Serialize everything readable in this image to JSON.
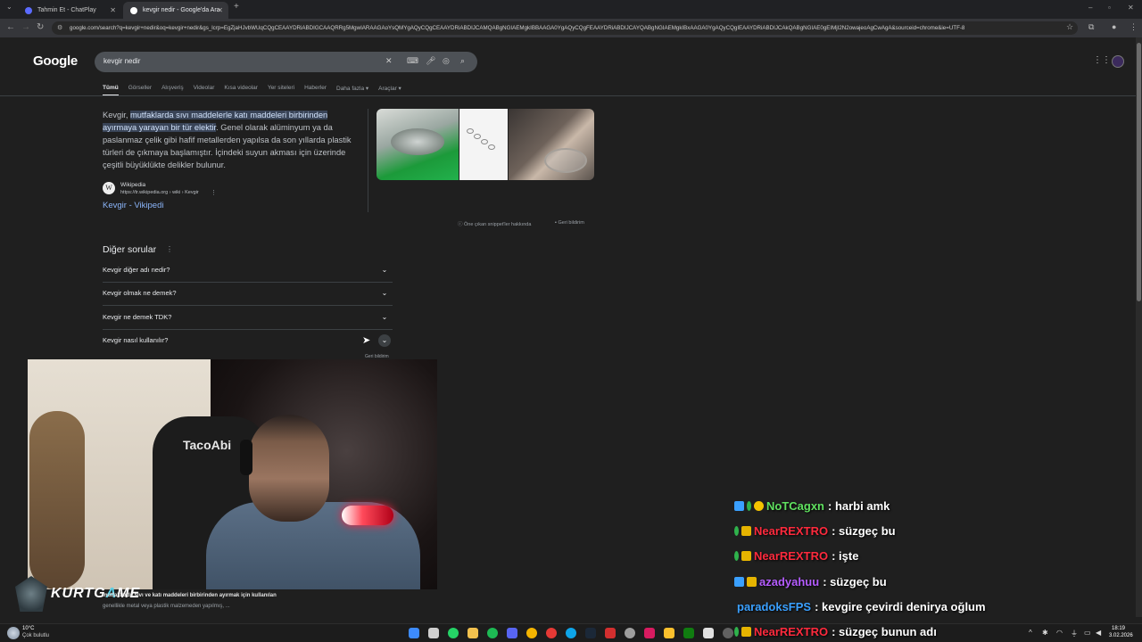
{
  "browser": {
    "tabs": [
      {
        "label": "Tahmin Et - ChatPlay",
        "active": false
      },
      {
        "label": "kevgir nedir - Google'da Ara",
        "active": true
      }
    ],
    "url": "google.com/search?q=kevgir+nedir&oq=kevgir+nedir&gs_lcrp=EgZjaHJvbWUqCQgCEAAYDRiABDIGCAAQRRg5MgwIARAAGAoYsQMYgAQyCQgCEAAYDRiABDIJCAMQABgNGIAEMgkIBBAAGA0YgAQyCQgFEAAYDRiABDIJCAYQABgNGIAEMgkIBxAAGA0YgAQyCQgIEAAYDRiABDIJCAkQABgNGIAE0gEIMjI2N2owajeoAgCwAgA&sourceid=chrome&ie=UTF-8"
  },
  "google": {
    "logo": "Google",
    "query": "kevgir nedir",
    "tabs": [
      "Tümü",
      "Görseller",
      "Alışveriş",
      "Videolar",
      "Kısa videolar",
      "Yer siteleri",
      "Haberler",
      "Daha fazla ▾",
      "Araçlar ▾"
    ],
    "snippet": {
      "prefix": "Kevgir, ",
      "highlight1": "mutfaklarda sıvı maddelerle katı maddeleri birbirinden",
      "highlight2": "ayırmaya yarayan bir tür elektir",
      "rest": ". Genel olarak alüminyum ya da paslanmaz çelik gibi hafif metallerden yapılsa da son yıllarda plastik türleri de çıkmaya başlamıştır. İçindeki suyun akması için üzerinde çeşitli büyüklükte delikler bulunur."
    },
    "source": {
      "icon": "W",
      "name": "Wikipedia",
      "url": "https://tr.wikipedia.org › wiki › Kevgir",
      "link": "Kevgir - Vikipedi"
    },
    "snippet_footer": {
      "about": "Öne çıkan snippet'ler hakkında",
      "feedback": "Geri bildirim"
    },
    "paa": {
      "title": "Diğer sorular",
      "questions": [
        "Kevgir diğer adı nedir?",
        "Kevgir olmak ne demek?",
        "Kevgir ne demek TDK?",
        "Kevgir nasıl kullanılır?"
      ],
      "feedback": "Geri bildirim"
    }
  },
  "stream": {
    "chair_label": "TacoAbi",
    "brand_a": "KURTG",
    "brand_b": "A",
    "brand_c": "ME",
    "sub1_bold": "mutfaklarda sıvı ve katı maddeleri birbirinden ayırmak için kullanılan",
    "sub2": "genellikle metal veya plastik malzemeden yapılmış, ...",
    "chat": [
      {
        "user": "NoTCagxn",
        "color": "#5fe05f",
        "msg": ": harbi amk"
      },
      {
        "user": "NearREXTRO",
        "color": "#ff2a3d",
        "msg": ": süzgeç bu"
      },
      {
        "user": "NearREXTRO",
        "color": "#ff2a3d",
        "msg": ": işte"
      },
      {
        "user": "azadyahuu",
        "color": "#b45cff",
        "msg": ": süzgeç bu"
      },
      {
        "user": "paradoksFPS",
        "color": "#3aa0ff",
        "msg": ": kevgire çevirdi denirya oğlum"
      },
      {
        "user": "NearREXTRO",
        "color": "#ff2a3d",
        "msg": ": süzgeç bunun adı"
      }
    ]
  },
  "taskbar": {
    "weather_temp": "10°C",
    "weather_desc": "Çok bulutlu",
    "time": "18:19",
    "date": "3.02.2026"
  },
  "colors": {
    "accent": "#8ab4f8",
    "highlight": "#a8c7fa",
    "background": "#1f1f1f"
  }
}
